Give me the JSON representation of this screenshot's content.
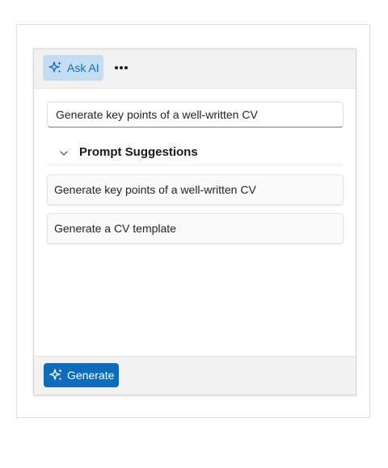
{
  "toolbar": {
    "ask_ai_label": "Ask AI",
    "ask_ai_icon": "sparkle-icon",
    "more_icon": "more-horizontal-icon"
  },
  "prompt": {
    "value": "Generate key points of a well-written CV"
  },
  "suggestions": {
    "title": "Prompt Suggestions",
    "expanded": true,
    "items": [
      {
        "label": "Generate key points of a well-written CV"
      },
      {
        "label": "Generate a CV template"
      }
    ]
  },
  "footer": {
    "generate_label": "Generate",
    "generate_icon": "sparkle-icon"
  },
  "colors": {
    "accent": "#0f6cbd",
    "ask_ai_bg": "#c5ddf1",
    "toolbar_bg": "#f2f2f2"
  }
}
